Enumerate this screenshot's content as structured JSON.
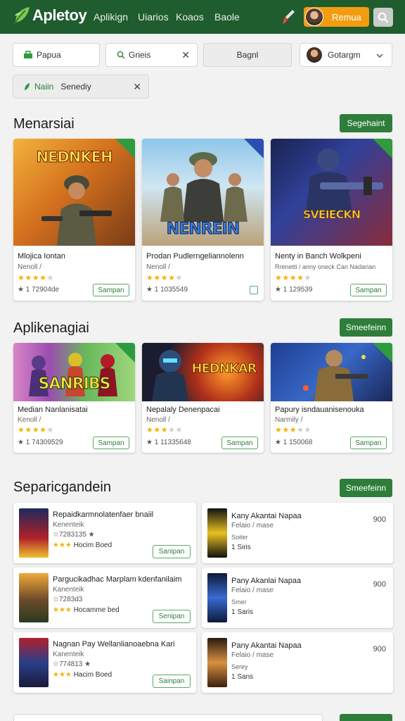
{
  "header": {
    "logo": "Apletoy",
    "nav": [
      "Aplikign",
      "Uiarios",
      "Koaos",
      "Baole"
    ],
    "user_label": "Remua"
  },
  "filters": {
    "f1": "Papua",
    "f2": "Grieis",
    "f3": "Bagnl",
    "f4": "Gotargm",
    "f5": "Naiin",
    "f5b": "Senediy"
  },
  "sections": [
    {
      "title": "Menarsiai",
      "button": "Segehaint",
      "cards": [
        {
          "art": "NEDNKEH",
          "name": "Mlojica Iontan",
          "sub": "Nenoll /",
          "count": "1 72904de",
          "rating": 4,
          "button": "Sampan"
        },
        {
          "art": "NENREIN",
          "name": "Prodan Pudlerngeliannolenn",
          "sub": "Nenoll /",
          "count": "1 1035549",
          "rating": 4,
          "button": ""
        },
        {
          "art": "SVEIECKN",
          "name": "Nenty in Banch Wolkpeni",
          "sub": "Rrenetti / anny oneck Can Nadarian",
          "count": "1 129539",
          "rating": 4,
          "button": "Sampan"
        }
      ]
    },
    {
      "title": "Aplikenagiai",
      "button": "Smeefeinn",
      "cards": [
        {
          "art": "SANRIBS",
          "name": "Median Nanlanisatai",
          "sub": "Kenoll /",
          "count": "1 74309529",
          "rating": 4,
          "button": "Sampan"
        },
        {
          "art": "HEDNKAR",
          "name": "Nepalaly Denenpacai",
          "sub": "Nenoll /",
          "count": "1 11335648",
          "rating": 3,
          "button": "Sampan"
        },
        {
          "art": "",
          "name": "Papury isndauanisenouka",
          "sub": "Narmily /",
          "count": "1 150068",
          "rating": 3,
          "button": "Sampan"
        }
      ]
    },
    {
      "title": "Separicgandein",
      "button": "Smeefeinn"
    }
  ],
  "list_left": [
    {
      "title": "Repaidkarmnolatenfaer bnaiil",
      "sub": "Kenenteik",
      "meta": "☆7283135 ★",
      "rating_label": "Hocim Boed",
      "button": "Sanipan"
    },
    {
      "title": "Pargucikadhac Marplam kdenfanilaim",
      "sub": "Kanenteik",
      "meta": "☆7283d3",
      "rating_label": "Hocamme bed",
      "button": "Senipan"
    },
    {
      "title": "Nagnan Pay Wellanlianoaebna Kari",
      "sub": "Kanenteik",
      "meta": "☆774813 ★",
      "rating_label": "Hacim Boed",
      "button": "Sainpan"
    }
  ],
  "list_right": [
    {
      "title": "Kany Akantai Napaa",
      "sub": "Felaio / mase",
      "info": "Soiter",
      "count": "1 Siris",
      "price": "900"
    },
    {
      "title": "Pany Akanlai Napaa",
      "sub": "Felaio / mase",
      "info": "Smer",
      "count": "1 Saris",
      "price": "900"
    },
    {
      "title": "Pany Akantai Napaa",
      "sub": "Felaio / mase",
      "info": "Serey",
      "count": "1 Sans",
      "price": "900"
    }
  ],
  "colors": {
    "header_bg": "#1f5c2e",
    "accent_green": "#2e7d3a",
    "user_chip": "#f39c12",
    "star": "#f2b400"
  },
  "icons": [
    "leaf-logo-icon",
    "brush-icon",
    "search-icon",
    "close-icon",
    "chevron-down-icon",
    "star-icon"
  ]
}
